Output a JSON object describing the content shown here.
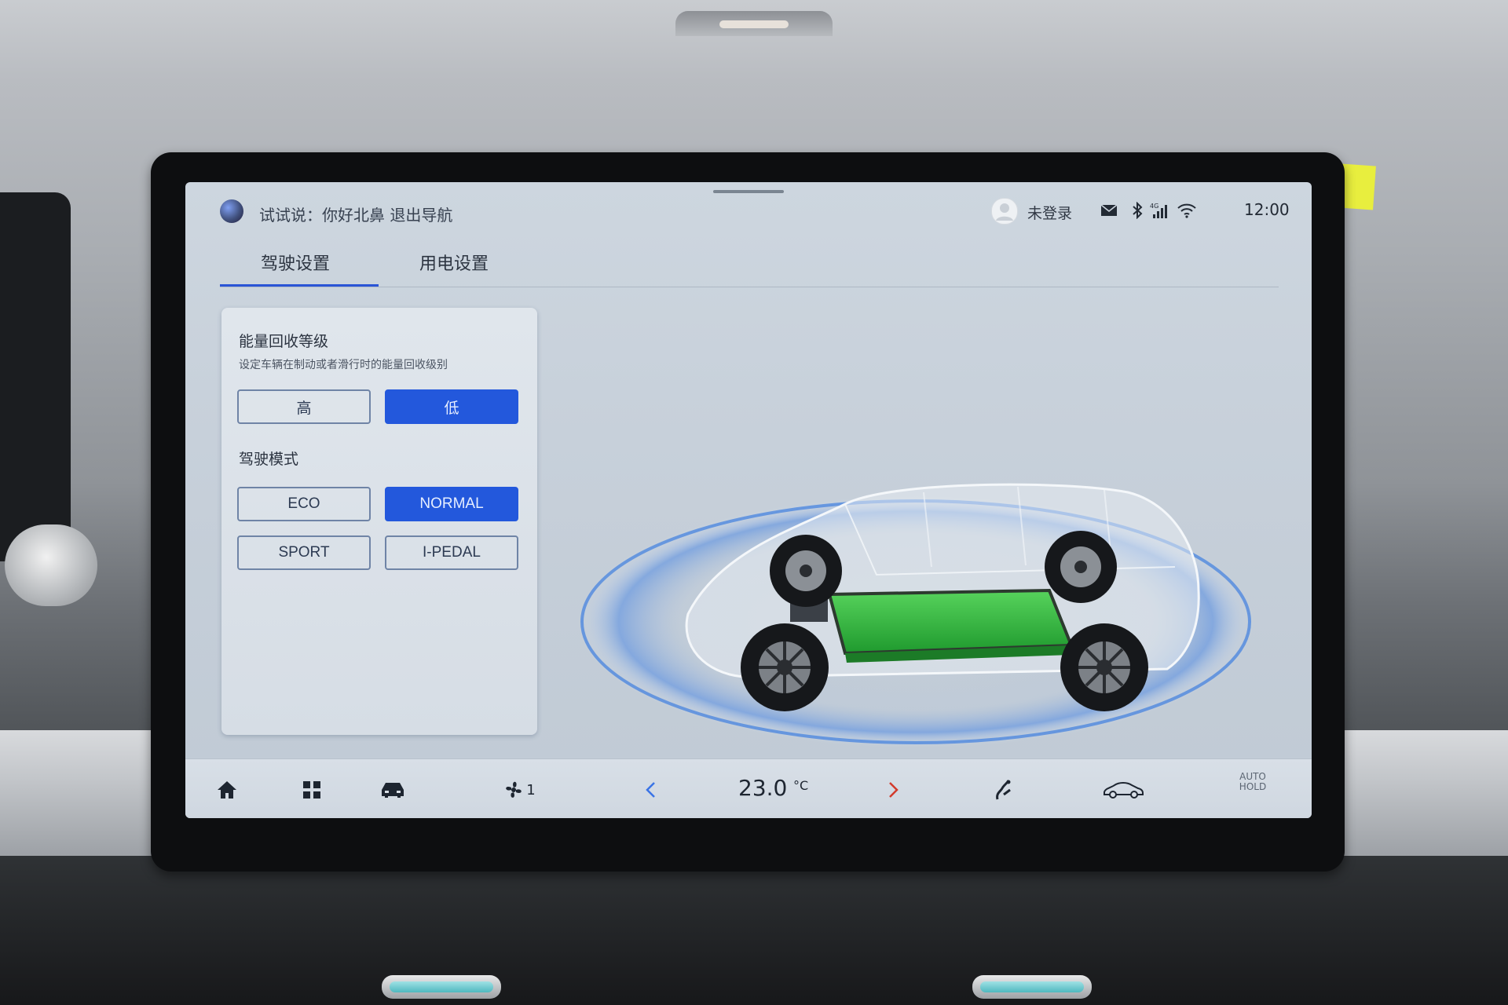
{
  "status_bar": {
    "assistant_hint": "试试说：你好北鼻 退出导航",
    "login_status": "未登录",
    "time": "12:00",
    "signal_label": "4G",
    "icons": [
      "assistant-orb",
      "avatar-icon",
      "mail-icon",
      "bluetooth-icon",
      "cellular-4g-icon",
      "wifi-icon"
    ]
  },
  "tabs": [
    {
      "label": "驾驶设置",
      "active": true
    },
    {
      "label": "用电设置",
      "active": false
    }
  ],
  "energy_recovery": {
    "title": "能量回收等级",
    "description": "设定车辆在制动或者滑行时的能量回收级别",
    "options": [
      {
        "label": "高",
        "selected": false
      },
      {
        "label": "低",
        "selected": true
      }
    ]
  },
  "drive_mode": {
    "title": "驾驶模式",
    "options": [
      {
        "label": "ECO",
        "selected": false
      },
      {
        "label": "NORMAL",
        "selected": true
      },
      {
        "label": "SPORT",
        "selected": false
      },
      {
        "label": "I-PEDAL",
        "selected": false
      }
    ]
  },
  "bottom_bar": {
    "fan_level": "1",
    "temperature": "23.0",
    "temperature_unit": "°C",
    "auto_hold_line1": "AUTO",
    "auto_hold_line2": "HOLD",
    "icons": [
      "home-icon",
      "apps-grid-icon",
      "car-icon",
      "fan-icon",
      "temp-decrease-icon",
      "temp-increase-icon",
      "seat-airflow-icon",
      "car-settings-icon"
    ]
  },
  "colors": {
    "accent": "#2358dc",
    "battery": "#2fb53d",
    "screen_bg": "#c7d0da"
  }
}
